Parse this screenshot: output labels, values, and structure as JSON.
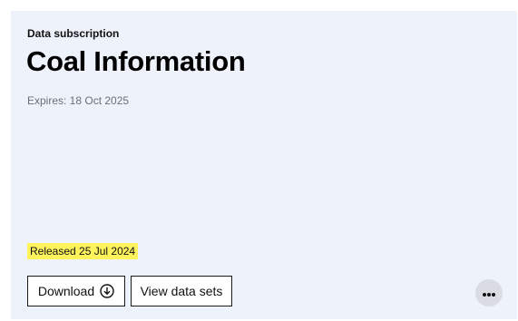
{
  "card": {
    "eyebrow": "Data subscription",
    "title": "Coal Information",
    "expires": "Expires: 18 Oct 2025",
    "released": "Released 25 Jul 2024",
    "download_label": "Download",
    "view_label": "View data sets"
  },
  "icons": {
    "download": "download-icon",
    "more": "more-options-icon"
  },
  "colors": {
    "card_background": "#eef2fb",
    "highlight": "#fff35c",
    "more_button": "#d9dce3"
  }
}
